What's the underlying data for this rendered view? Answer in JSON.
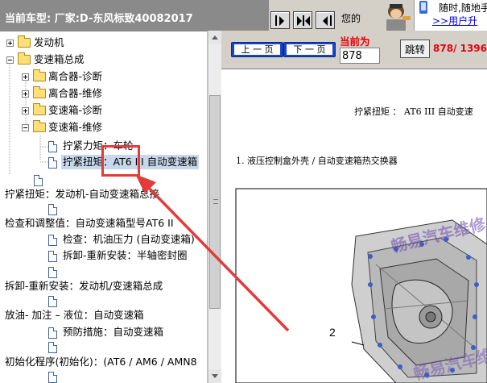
{
  "topbar": {
    "vehicle_label": "当前车型:  厂家:D-东风标致40082017",
    "ad_text": "您的",
    "ad_line1": "随时,随地手",
    "ad_link": ">>用户升"
  },
  "tree": {
    "nodes": [
      {
        "label": "发动机",
        "kind": "folder",
        "toggle": "plus"
      },
      {
        "label": "变速箱总成",
        "kind": "folder",
        "toggle": "minus"
      },
      {
        "label": "离合器-诊断",
        "kind": "folder",
        "toggle": "plus"
      },
      {
        "label": "离合器-维修",
        "kind": "folder",
        "toggle": "plus"
      },
      {
        "label": "变速箱-诊断",
        "kind": "folder",
        "toggle": "plus"
      },
      {
        "label": "变速箱-维修",
        "kind": "folder",
        "toggle": "minus"
      },
      {
        "label": "拧紧力矩：车轮",
        "kind": "doc"
      },
      {
        "label": "拧紧扭矩：AT6 III 自动变速箱",
        "kind": "doc",
        "selected": true
      },
      {
        "label": "拧紧扭矩：发动机-自动变速箱总接",
        "kind": "text"
      },
      {
        "label": "检查和调整值：自动变速箱型号AT6 II",
        "kind": "text"
      },
      {
        "label": "检查：机油压力 (自动变速箱)",
        "kind": "doc"
      },
      {
        "label": "拆卸-重新安装：半轴密封圈",
        "kind": "doc"
      },
      {
        "label": "拆卸-重新安装：发动机/变速箱总成",
        "kind": "text"
      },
      {
        "label": "放油- 加注 – 液位：自动变速箱",
        "kind": "text"
      },
      {
        "label": "预防措施：自动变速箱",
        "kind": "doc"
      },
      {
        "label": "初始化程序(初始化)：(AT6 / AM6 / AMN8",
        "kind": "text"
      }
    ]
  },
  "controls": {
    "prev_label": "上 一 页",
    "next_label": "下 一 页",
    "current_label": "当前为",
    "page_value": "878",
    "jump_label": "跳转",
    "page_count": "878/ 1396"
  },
  "content": {
    "title": "拧紧扭矩 ： AT6 III 自动变速",
    "step": "1.  液压控制盒外壳 / 自动变速箱热交换器",
    "callout": "2",
    "watermark": "畅易汽车维修"
  },
  "colors": {
    "accent_red": "#e43a3a",
    "button_blue": "#1846c8",
    "selection": "#c8d8ec",
    "watermark": "#6a4ab0"
  }
}
